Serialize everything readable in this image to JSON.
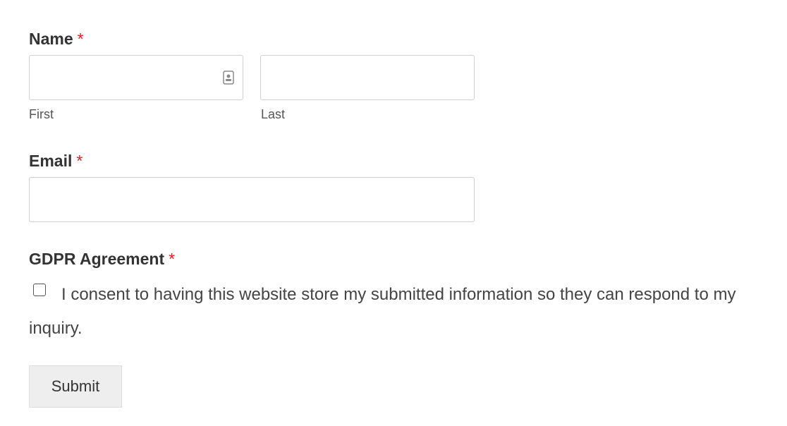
{
  "form": {
    "required_marker": "*",
    "name": {
      "label": "Name",
      "first": {
        "value": "",
        "sublabel": "First"
      },
      "last": {
        "value": "",
        "sublabel": "Last"
      },
      "first_field_icon": "contact-card-icon"
    },
    "email": {
      "label": "Email",
      "value": ""
    },
    "gdpr": {
      "label": "GDPR Agreement",
      "checked": false,
      "consent_text": "I consent to having this website store my submitted information so they can respond to my inquiry."
    },
    "submit_label": "Submit"
  },
  "colors": {
    "required": "#e02020",
    "label_text": "#333333",
    "input_border": "#cfcfcf",
    "button_bg": "#eeeeee"
  }
}
